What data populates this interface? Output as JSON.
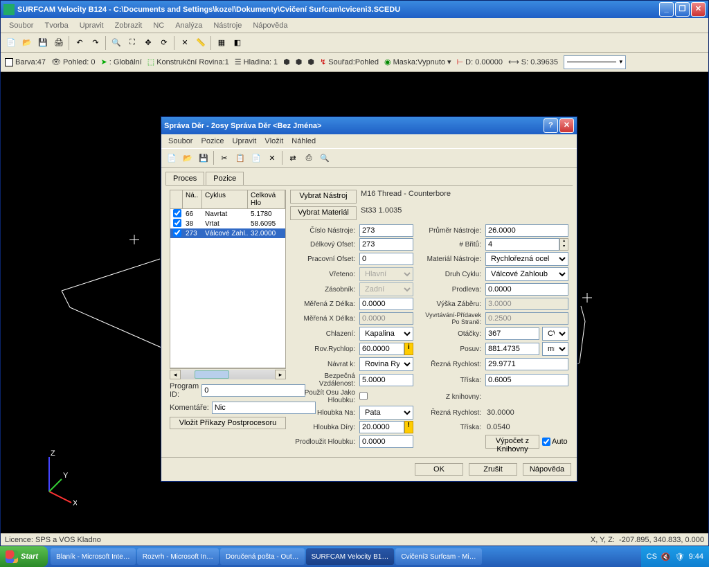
{
  "main": {
    "title": "SURFCAM Velocity B124 - C:\\Documents and Settings\\kozel\\Dokumenty\\Cvičení Surfcam\\cviceni3.SCEDU",
    "menu": [
      "Soubor",
      "Tvorba",
      "Upravit",
      "Zobrazit",
      "NC",
      "Analýza",
      "Nástroje",
      "Nápověda"
    ]
  },
  "propbar": {
    "barva": "Barva:47",
    "pohled": "Pohled: 0",
    "global": ": Globální",
    "krovina": "Konstrukční Rovina:1",
    "hladina": "Hladina: 1",
    "sourad": "Souřad:Pohled",
    "maska": "Maska:Vypnuto",
    "d": "D: 0.00000",
    "s": "S: 0.39635"
  },
  "status": {
    "left": "Licence: SPS a VOS Kladno",
    "coordlabel": "X, Y, Z:",
    "coords": "-207.895, 340.833, 0.000"
  },
  "dialog": {
    "title": "Správa Děr - 2osy Správa Děr <Bez Jména>",
    "menu": [
      "Soubor",
      "Pozice",
      "Upravit",
      "Vložit",
      "Náhled"
    ],
    "tabs": [
      "Proces",
      "Pozice"
    ],
    "columns": [
      "Ná..",
      "Cyklus",
      "Celková Hlo"
    ],
    "rows": [
      {
        "chk": true,
        "n": "66",
        "cyklus": "Navrtat",
        "hl": "5.1780",
        "sel": false
      },
      {
        "chk": true,
        "n": "38",
        "cyklus": "Vrtat",
        "hl": "58.6095",
        "sel": false
      },
      {
        "chk": true,
        "n": "273",
        "cyklus": "Válcové Zahl..",
        "hl": "32.0000",
        "sel": true
      }
    ],
    "programid_lbl": "Program ID:",
    "programid": "0",
    "komentare_lbl": "Komentáře:",
    "komentare": "Nic",
    "vlozit_btn": "Vložit Příkazy Postprocesoru",
    "top_buttons": {
      "vyb_nastroj": "Vybrat Nástroj",
      "vyb_material": "Vybrat Materiál"
    },
    "top_vals": {
      "nastroj": "M16  Thread  -  Counterbore",
      "material": "St33 1.0035"
    },
    "form": {
      "cislo_nastroje_lbl": "Číslo Nástroje:",
      "cislo_nastroje": "273",
      "prumer_lbl": "Průměr Nástroje:",
      "prumer": "26.0000",
      "delk_ofset_lbl": "Délkový Ofset:",
      "delk_ofset": "273",
      "britu_lbl": "# Břitů:",
      "britu": "4",
      "prac_ofset_lbl": "Pracovní Ofset:",
      "prac_ofset": "0",
      "mat_nastroje_lbl": "Materiál Nástroje:",
      "mat_nastroje": "Rychlořezná ocel",
      "vreteno_lbl": "Vřeteno:",
      "vreteno": "Hlavní",
      "druh_cyklu_lbl": "Druh Cyklu:",
      "druh_cyklu": "Válcové Zahloub",
      "zasobnik_lbl": "Zásobník:",
      "zasobnik": "Zadní",
      "prodleva_lbl": "Prodleva:",
      "prodleva": "0.0000",
      "mz_lbl": "Měřená Z Délka:",
      "mz": "0.0000",
      "vyska_lbl": "Výška Záběru:",
      "vyska": "3.0000",
      "mx_lbl": "Měřená X Délka:",
      "mx": "0.0000",
      "vyvrt_lbl": "Vyvrtávání-Přídavek Po Straně:",
      "vyvrt": "0.2500",
      "chlazeni_lbl": "Chlazení:",
      "chlazeni": "Kapalina",
      "otacky_lbl": "Otáčky:",
      "otacky": "367",
      "otacky_unit": "CW",
      "rov_lbl": "Rov.Rychlop:",
      "rov": "60.0000",
      "posuv_lbl": "Posuv:",
      "posuv": "881.4735",
      "posuv_unit": "mm/r",
      "navrat_lbl": "Návrat k:",
      "navrat": "Rovina Rychlop.",
      "rezna_lbl": "Řezná Rychlost:",
      "rezna": "29.9771",
      "bezp_lbl": "Bezpečná Vzdálenost:",
      "bezp": "5.0000",
      "triska_lbl": "Tříska:",
      "triska": "0.6005",
      "pouzitosu_lbl": "Použít Osu Jako Hloubku:",
      "zknihovny_lbl": "Z knihovny:",
      "hloubka_na_lbl": "Hloubka Na:",
      "hloubka_na": "Pata",
      "rezna2_lbl": "Řezná Rychlost:",
      "rezna2": "30.0000",
      "hloubka_diry_lbl": "Hloubka Díry:",
      "hloubka_diry": "20.0000",
      "triska2_lbl": "Tříska:",
      "triska2": "0.0540",
      "prodl_lbl": "Prodloužit Hloubku:",
      "prodl": "0.0000",
      "vypocet_btn": "Výpočet z Knihovny",
      "auto_lbl": "Auto"
    },
    "footer": {
      "ok": "OK",
      "zrusit": "Zrušit",
      "napoveda": "Nápověda"
    }
  },
  "taskbar": {
    "start": "Start",
    "items": [
      "Blaník - Microsoft Inte…",
      "Rozvrh - Microsoft In…",
      "Doručená pošta - Out…",
      "SURFCAM Velocity B1…",
      "Cvičení3 Surfcam - Mi…"
    ],
    "lang": "CS",
    "time": "9:44"
  }
}
